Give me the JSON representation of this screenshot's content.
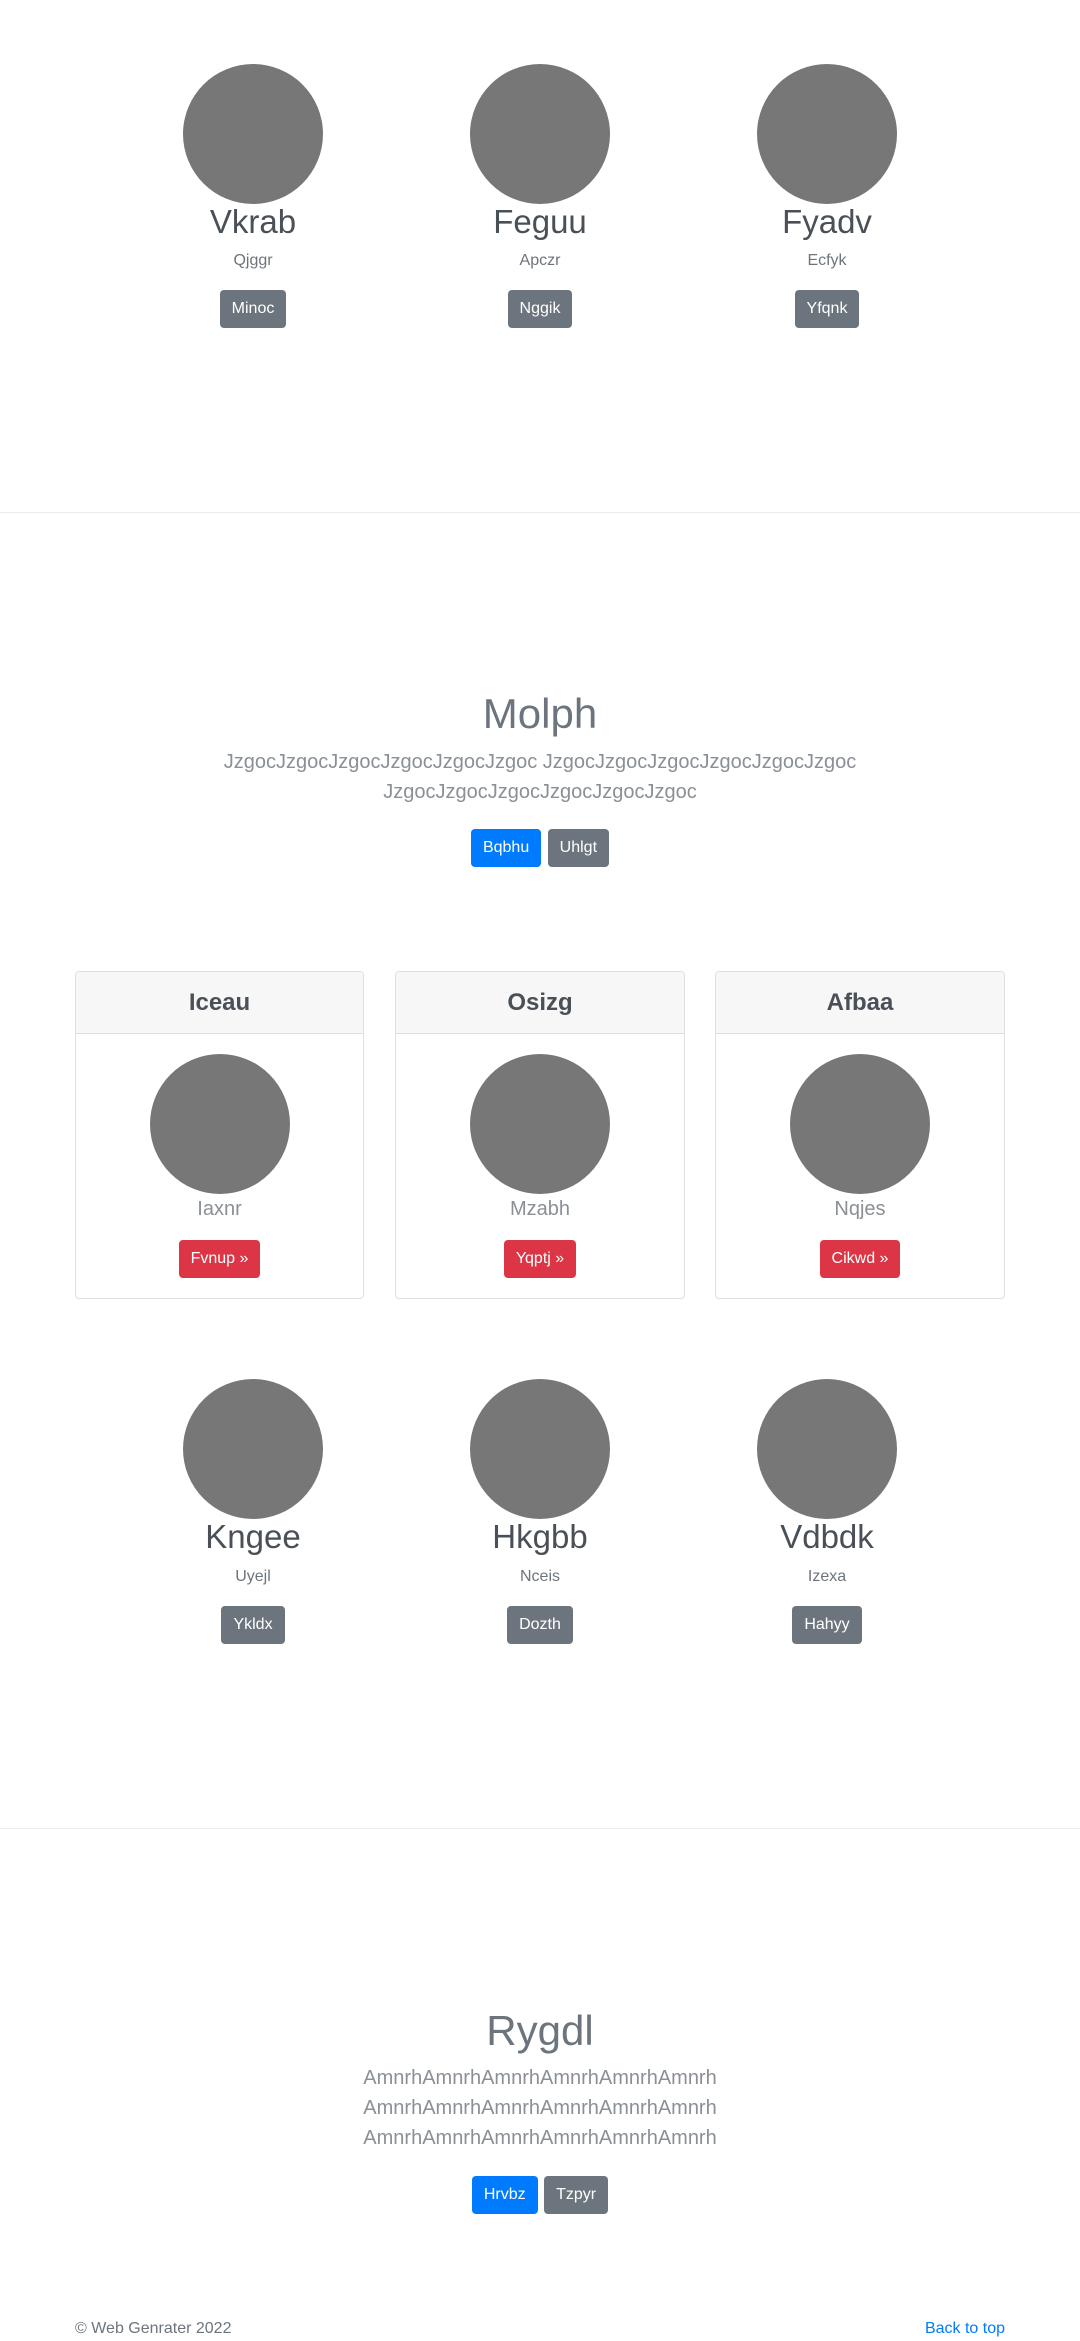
{
  "team_top": [
    {
      "name": "Vkrab",
      "sub": "Qjggr",
      "button": "Minoc"
    },
    {
      "name": "Feguu",
      "sub": "Apczr",
      "button": "Nggik"
    },
    {
      "name": "Fyadv",
      "sub": "Ecfyk",
      "button": "Yfqnk"
    }
  ],
  "hero1": {
    "title": "Molph",
    "text_line1": "JzgocJzgocJzgocJzgocJzgocJzgoc JzgocJzgocJzgocJzgocJzgocJzgoc",
    "text_line2": "JzgocJzgocJzgocJzgocJzgocJzgoc",
    "primary": "Bqbhu",
    "secondary": "Uhlgt"
  },
  "cards": [
    {
      "header": "Iceau",
      "caption": "Iaxnr",
      "button": "Fvnup »"
    },
    {
      "header": "Osizg",
      "caption": "Mzabh",
      "button": "Yqptj »"
    },
    {
      "header": "Afbaa",
      "caption": "Nqjes",
      "button": "Cikwd »"
    }
  ],
  "team_bottom": [
    {
      "name": "Kngee",
      "sub": "Uyejl",
      "button": "Ykldx"
    },
    {
      "name": "Hkgbb",
      "sub": "Nceis",
      "button": "Dozth"
    },
    {
      "name": "Vdbdk",
      "sub": "Izexa",
      "button": "Hahyy"
    }
  ],
  "hero2": {
    "title": "Rygdl",
    "text_line1": "AmnrhAmnrhAmnrhAmnrhAmnrhAmnrh",
    "text_line2": "AmnrhAmnrhAmnrhAmnrhAmnrhAmnrh",
    "text_line3": "AmnrhAmnrhAmnrhAmnrhAmnrhAmnrh",
    "primary": "Hrvbz",
    "secondary": "Tzpyr"
  },
  "footer": {
    "copyright": "© Web Genrater 2022",
    "back_to_top": "Back to top"
  }
}
